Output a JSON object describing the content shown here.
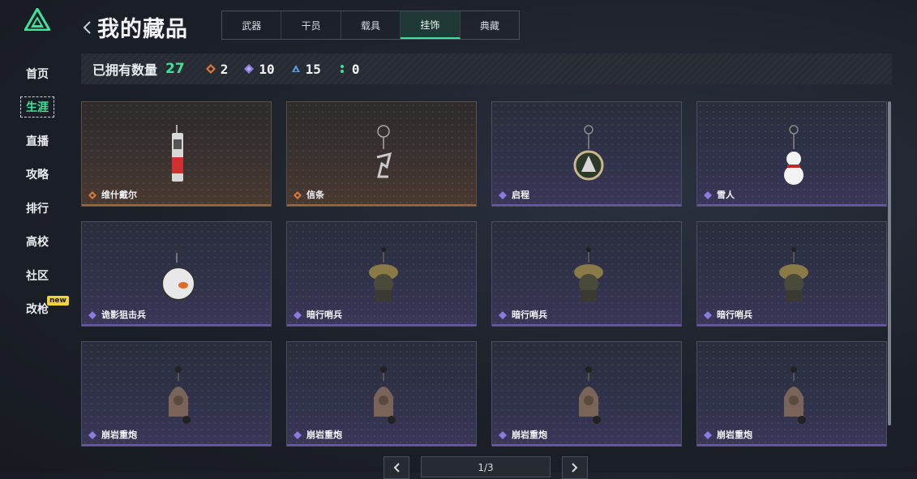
{
  "page": {
    "title": "我的藏品"
  },
  "sidebar": {
    "items": [
      {
        "label": "首页",
        "active": false
      },
      {
        "label": "生涯",
        "active": true
      },
      {
        "label": "直播",
        "active": false
      },
      {
        "label": "攻略",
        "active": false
      },
      {
        "label": "排行",
        "active": false
      },
      {
        "label": "高校",
        "active": false
      },
      {
        "label": "社区",
        "active": false
      },
      {
        "label": "改枪",
        "active": false,
        "badge": "new"
      }
    ]
  },
  "tabs": [
    {
      "label": "武器",
      "active": false
    },
    {
      "label": "干员",
      "active": false
    },
    {
      "label": "载具",
      "active": false
    },
    {
      "label": "挂饰",
      "active": true
    },
    {
      "label": "典藏",
      "active": false
    }
  ],
  "stats": {
    "owned_label": "已拥有数量",
    "owned_total": "27",
    "counts": [
      {
        "icon": "orange-diamond-icon",
        "color": "#d97a3a",
        "value": "2"
      },
      {
        "icon": "purple-diamond-icon",
        "color": "#8b7be0",
        "value": "10"
      },
      {
        "icon": "blue-triangle-icon",
        "color": "#5aa0e0",
        "value": "15"
      },
      {
        "icon": "green-dots-icon",
        "color": "#3ee39a",
        "value": "0"
      }
    ]
  },
  "items": [
    {
      "name": "维什戴尔",
      "rarity": "orange"
    },
    {
      "name": "信条",
      "rarity": "orange"
    },
    {
      "name": "启程",
      "rarity": "purple"
    },
    {
      "name": "雪人",
      "rarity": "purple"
    },
    {
      "name": "诡影狙击兵",
      "rarity": "purple"
    },
    {
      "name": "暗行哨兵",
      "rarity": "purple"
    },
    {
      "name": "暗行哨兵",
      "rarity": "purple"
    },
    {
      "name": "暗行哨兵",
      "rarity": "purple"
    },
    {
      "name": "崩岩重炮",
      "rarity": "purple"
    },
    {
      "name": "崩岩重炮",
      "rarity": "purple"
    },
    {
      "name": "崩岩重炮",
      "rarity": "purple"
    },
    {
      "name": "崩岩重炮",
      "rarity": "purple"
    }
  ],
  "pagination": {
    "label": "1/3"
  },
  "colors": {
    "accent": "#3ee39a",
    "orange": "#d97a3a",
    "purple": "#8b7be0"
  }
}
